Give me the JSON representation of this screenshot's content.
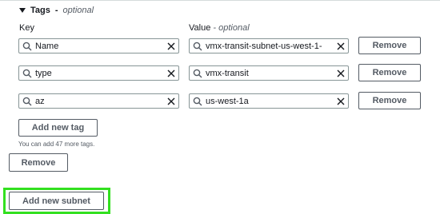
{
  "tags_section": {
    "title": "Tags",
    "separator": "-",
    "optional": "optional"
  },
  "columns": {
    "key_label": "Key",
    "value_label": "Value",
    "value_separator": "-",
    "value_optional": "optional"
  },
  "tags": [
    {
      "key": "Name",
      "value": "vmx-transit-subnet-us-west-1-",
      "remove_label": "Remove"
    },
    {
      "key": "type",
      "value": "vmx-transit",
      "remove_label": "Remove"
    },
    {
      "key": "az",
      "value": "us-west-1a",
      "remove_label": "Remove"
    }
  ],
  "add_tag_label": "Add new tag",
  "tag_limit_hint": "You can add 47 more tags.",
  "remove_subnet_label": "Remove",
  "add_subnet_label": "Add new subnet",
  "highlight_color": "#33e020",
  "icons": {
    "search": "search-icon",
    "clear": "close-icon",
    "caret": "caret-down-icon"
  }
}
